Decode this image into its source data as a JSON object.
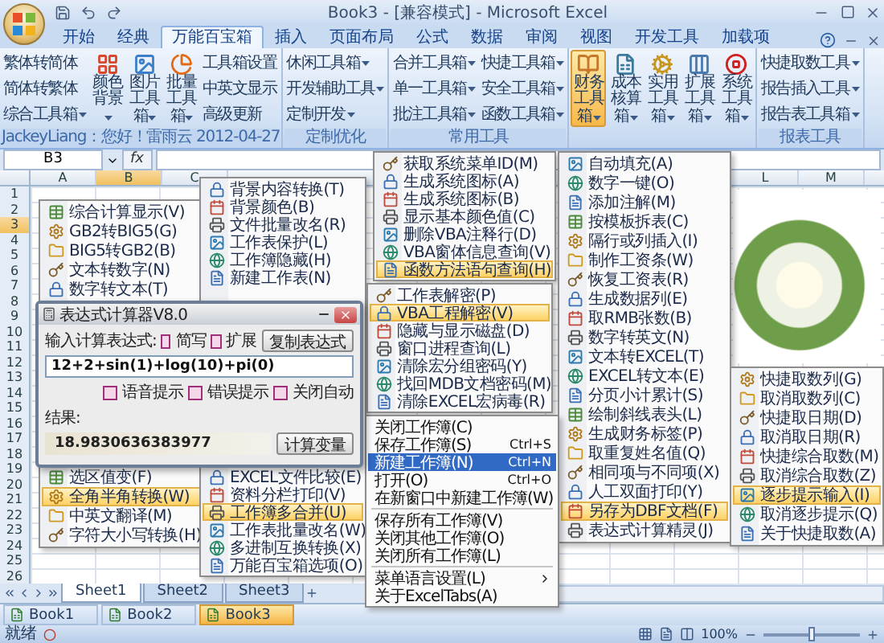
{
  "window": {
    "title": "Book3 - [兼容模式] - Microsoft Excel"
  },
  "tabs": [
    {
      "label": "开始",
      "selected": false
    },
    {
      "label": "经典",
      "selected": false
    },
    {
      "label": "万能百宝箱",
      "selected": true
    },
    {
      "label": "插入",
      "selected": false
    },
    {
      "label": "页面布局",
      "selected": false
    },
    {
      "label": "公式",
      "selected": false
    },
    {
      "label": "数据",
      "selected": false
    },
    {
      "label": "审阅",
      "selected": false
    },
    {
      "label": "视图",
      "selected": false
    },
    {
      "label": "开发工具",
      "selected": false
    },
    {
      "label": "加载项",
      "selected": false
    }
  ],
  "ribbon": {
    "groups": [
      {
        "label": "JackeyLiang：您好！雷雨云 2012-04-27",
        "controls": [
          {
            "kind": "small",
            "label": "繁体转简体",
            "dropdown": false
          },
          {
            "kind": "small",
            "label": "简体转繁体",
            "dropdown": false
          },
          {
            "kind": "small",
            "label": "综合工具箱",
            "dropdown": true
          },
          {
            "kind": "large",
            "label": "颜色背景",
            "dropdown": true,
            "active": false
          },
          {
            "kind": "large",
            "label": "图片工具箱",
            "dropdown": true,
            "active": false
          },
          {
            "kind": "large",
            "label": "批量工具箱",
            "dropdown": true,
            "active": false
          },
          {
            "kind": "small",
            "label": "工具箱设置",
            "dropdown": false
          },
          {
            "kind": "small",
            "label": "中英文显示",
            "dropdown": false
          },
          {
            "kind": "small",
            "label": "高级更新",
            "dropdown": false
          }
        ]
      },
      {
        "label": "定制优化",
        "controls": [
          {
            "kind": "small",
            "label": "休闲工具箱",
            "dropdown": true
          },
          {
            "kind": "small",
            "label": "开发辅助工具",
            "dropdown": true
          },
          {
            "kind": "small",
            "label": "定制开发",
            "dropdown": true
          }
        ]
      },
      {
        "label": "常用工具",
        "controls": [
          {
            "kind": "small",
            "label": "合并工具箱",
            "dropdown": true
          },
          {
            "kind": "small",
            "label": "单一工具箱",
            "dropdown": true
          },
          {
            "kind": "small",
            "label": "批注工具箱",
            "dropdown": true
          },
          {
            "kind": "small",
            "label": "快捷工具箱",
            "dropdown": true
          },
          {
            "kind": "small",
            "label": "安全工具箱",
            "dropdown": true
          },
          {
            "kind": "small",
            "label": "函数工具箱",
            "dropdown": true
          }
        ]
      },
      {
        "controls": [
          {
            "kind": "large",
            "label": "财务工具箱",
            "dropdown": true,
            "active": true
          },
          {
            "kind": "large",
            "label": "成本核算箱",
            "dropdown": true,
            "active": false
          },
          {
            "kind": "large",
            "label": "实用工具箱",
            "dropdown": true,
            "active": false
          },
          {
            "kind": "large",
            "label": "扩展工具箱",
            "dropdown": true,
            "active": false
          },
          {
            "kind": "large",
            "label": "系统工具箱",
            "dropdown": true,
            "active": false
          }
        ]
      },
      {
        "label": "报表工具",
        "controls": [
          {
            "kind": "small",
            "label": "快捷取数工具",
            "dropdown": true
          },
          {
            "kind": "small",
            "label": "报告插入工具",
            "dropdown": true
          },
          {
            "kind": "small",
            "label": "报告表工具箱",
            "dropdown": true
          }
        ]
      }
    ]
  },
  "formula_bar": {
    "name_box": "B3",
    "function_button": "fx"
  },
  "columns": [
    {
      "label": "A",
      "selected": false
    },
    {
      "label": "B",
      "selected": true
    },
    {
      "label": "C",
      "selected": false
    }
  ],
  "columns_right": [
    {
      "label": "L",
      "selected": false
    },
    {
      "label": "M",
      "selected": false
    }
  ],
  "rows": [
    {
      "label": "1",
      "selected": false
    },
    {
      "label": "2",
      "selected": false
    },
    {
      "label": "3",
      "selected": true
    },
    {
      "label": "4",
      "selected": false
    },
    {
      "label": "5",
      "selected": false
    },
    {
      "label": "6",
      "selected": false
    },
    {
      "label": "7",
      "selected": false
    },
    {
      "label": "8",
      "selected": false
    },
    {
      "label": "9",
      "selected": false
    },
    {
      "label": "10",
      "selected": false
    },
    {
      "label": "11",
      "selected": false
    },
    {
      "label": "12",
      "selected": false
    },
    {
      "label": "13",
      "selected": false
    },
    {
      "label": "14",
      "selected": false
    },
    {
      "label": "15",
      "selected": false
    },
    {
      "label": "16",
      "selected": false
    },
    {
      "label": "17",
      "selected": false
    },
    {
      "label": "18",
      "selected": false
    },
    {
      "label": "19",
      "selected": false
    },
    {
      "label": "20",
      "selected": false
    },
    {
      "label": "21",
      "selected": false
    },
    {
      "label": "22",
      "selected": false
    },
    {
      "label": "23",
      "selected": false
    },
    {
      "label": "24",
      "selected": false
    },
    {
      "label": "25",
      "selected": false
    },
    {
      "label": "26",
      "selected": false
    }
  ],
  "text_menu": {
    "items_above": [
      {
        "label": "综合计算显示(V)",
        "selected": false
      },
      {
        "label": "GB2转BIG5(G)",
        "selected": false
      },
      {
        "label": "BIG5转GB2(B)",
        "selected": false
      },
      {
        "label": "文本转数字(N)",
        "selected": false
      },
      {
        "label": "数字转文本(T)",
        "selected": false
      }
    ],
    "items_below": [
      {
        "label": "选区值变(F)",
        "selected": false
      },
      {
        "label": "全角半角转换(W)",
        "selected": true
      },
      {
        "label": "中英文翻译(M)",
        "selected": false
      },
      {
        "label": "字符大小写转换(H)",
        "selected": false
      }
    ]
  },
  "workbook_menu": {
    "items_above": [
      {
        "label": "背景内容转换(T)",
        "selected": false
      },
      {
        "label": "背景颜色(B)",
        "selected": false
      },
      {
        "label": "文件批量改名(R)",
        "selected": false
      },
      {
        "label": "工作表保护(L)",
        "selected": false
      },
      {
        "label": "工作簿隐藏(H)",
        "selected": false
      },
      {
        "label": "新建工作表(N)",
        "selected": false
      }
    ],
    "items_below": [
      {
        "label": "EXCEL文件比较(E)",
        "selected": false
      },
      {
        "label": "资料分栏打印(V)",
        "selected": false
      },
      {
        "label": "工作簿多合并(U)",
        "selected": true
      },
      {
        "label": "工作表批量改名(W)",
        "selected": false
      },
      {
        "label": "多进制互换转换(X)",
        "selected": false
      },
      {
        "label": "万能百宝箱选项(O)",
        "selected": false
      }
    ]
  },
  "dev_menu": {
    "items": [
      {
        "label": "获取系统菜单ID(M)",
        "selected": false
      },
      {
        "label": "生成系统图标(A)",
        "selected": false
      },
      {
        "label": "生成系统图标(B)",
        "selected": false
      },
      {
        "label": "显示基本颜色值(C)",
        "selected": false
      },
      {
        "label": "删除VBA注释行(D)",
        "selected": false
      },
      {
        "label": "VBA窗体信息查询(V)",
        "selected": false
      },
      {
        "label": "函数方法语句查询(H)",
        "selected": true
      }
    ]
  },
  "vba_menu": {
    "items": [
      {
        "label": "工作表解密(P)",
        "selected": false
      },
      {
        "label": "VBA工程解密(V)",
        "selected": true
      },
      {
        "label": "隐藏与显示磁盘(D)",
        "selected": false
      },
      {
        "label": "窗口进程查询(L)",
        "selected": false
      },
      {
        "label": "清除宏分组密码(Y)",
        "selected": false
      },
      {
        "label": "找回MDB文档密码(M)",
        "selected": false
      },
      {
        "label": "清除EXCEL宏病毒(R)",
        "selected": false
      }
    ]
  },
  "tab_context_menu": {
    "items": [
      {
        "kind": "item",
        "label": "关闭工作簿(C)",
        "selected": false
      },
      {
        "kind": "item",
        "label": "保存工作簿(S)",
        "shortcut": "Ctrl+S",
        "selected": false
      },
      {
        "kind": "item",
        "label": "新建工作簿(N)",
        "shortcut": "Ctrl+N",
        "selected": true
      },
      {
        "kind": "item",
        "label": "打开(O)",
        "shortcut": "Ctrl+O",
        "selected": false
      },
      {
        "kind": "item",
        "label": "在新窗口中新建工作簿(W)",
        "selected": false
      },
      {
        "kind": "separator"
      },
      {
        "kind": "item",
        "label": "保存所有工作簿(V)",
        "selected": false
      },
      {
        "kind": "item",
        "label": "关闭其他工作簿(O)",
        "selected": false
      },
      {
        "kind": "item",
        "label": "关闭所有工作簿(L)",
        "selected": false
      },
      {
        "kind": "separator"
      },
      {
        "kind": "item",
        "label": "菜单语言设置(L)",
        "selected": false,
        "submenu": true
      },
      {
        "kind": "item",
        "label": "关于ExcelTabs(A)",
        "selected": false
      }
    ]
  },
  "finance_menu": {
    "items": [
      {
        "label": "自动填充(A)",
        "selected": false
      },
      {
        "label": "数字一键(O)",
        "selected": false
      },
      {
        "label": "添加注解(M)",
        "selected": false
      },
      {
        "label": "按模板拆表(C)",
        "selected": false
      },
      {
        "label": "隔行或列插入(I)",
        "selected": false
      },
      {
        "label": "制作工资条(W)",
        "selected": false
      },
      {
        "label": "恢复工资表(R)",
        "selected": false
      },
      {
        "label": "生成数据列(E)",
        "selected": false
      },
      {
        "label": "取RMB张数(B)",
        "selected": false
      },
      {
        "label": "数字转英文(N)",
        "selected": false
      },
      {
        "label": "文本转EXCEL(T)",
        "selected": false
      },
      {
        "label": "EXCEL转文本(E)",
        "selected": false
      },
      {
        "label": "分页小计累计(S)",
        "selected": false
      },
      {
        "label": "绘制斜线表头(L)",
        "selected": false
      },
      {
        "label": "生成财务标签(P)",
        "selected": false
      },
      {
        "label": "取重复姓名值(Q)",
        "selected": false
      },
      {
        "label": "相同项与不同项(X)",
        "selected": false
      },
      {
        "label": "人工双面打印(Y)",
        "selected": false
      },
      {
        "label": "另存为DBF文档(F)",
        "selected": true
      },
      {
        "label": "表达式计算精灵(J)",
        "selected": false
      }
    ]
  },
  "quick_fetch_menu": {
    "items": [
      {
        "label": "快捷取数列(G)",
        "selected": false
      },
      {
        "label": "取消取数列(C)",
        "selected": false
      },
      {
        "label": "快捷取日期(D)",
        "selected": false
      },
      {
        "label": "取消取日期(R)",
        "selected": false
      },
      {
        "label": "快捷综合取数(M)",
        "selected": false
      },
      {
        "label": "取消综合取数(Z)",
        "selected": false
      },
      {
        "label": "逐步提示输入(I)",
        "selected": true
      },
      {
        "label": "取消逐步提示(Q)",
        "selected": false
      },
      {
        "label": "关于快捷取数(A)",
        "selected": false
      }
    ]
  },
  "calculator_dialog": {
    "title": "表达式计算器V8.0",
    "expression_label": "输入计算表达式:",
    "options": [
      {
        "label": "简写",
        "checked": false
      },
      {
        "label": "扩展",
        "checked": false
      }
    ],
    "copy_button": "复制表达式",
    "expression": "12+2+sin(1)+log(10)+pi(0)",
    "hints": [
      {
        "label": "语音提示",
        "checked": false
      },
      {
        "label": "错误提示",
        "checked": false
      },
      {
        "label": "关闭自动",
        "checked": false
      }
    ],
    "result_label": "结果:",
    "result": "18.9830636383977",
    "calculate_button": "计算变量"
  },
  "sheet_tabs": [
    {
      "label": "Sheet1",
      "selected": true
    },
    {
      "label": "Sheet2",
      "selected": false
    },
    {
      "label": "Sheet3",
      "selected": false
    }
  ],
  "workbook_tabs": [
    {
      "label": "Book1",
      "selected": false
    },
    {
      "label": "Book2",
      "selected": false
    },
    {
      "label": "Book3",
      "selected": true
    }
  ],
  "status_bar": {
    "status": "就绪",
    "zoom": "100%",
    "zoom_slider": {
      "level": 0.5
    }
  }
}
